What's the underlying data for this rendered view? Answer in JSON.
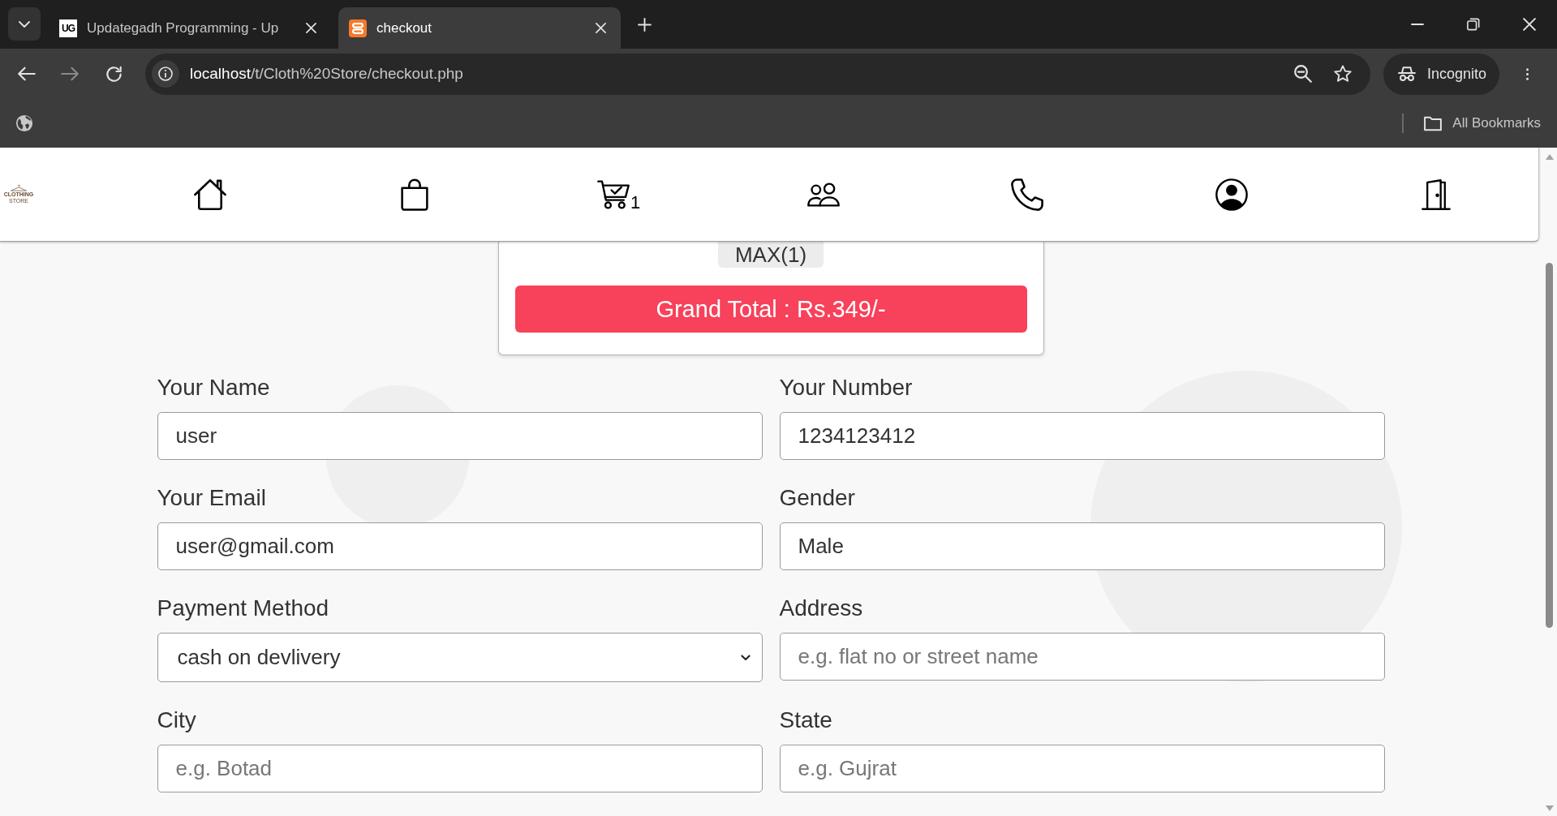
{
  "browser": {
    "tabs": [
      {
        "title": "Updategadh Programming - Up",
        "favicon_text": "UG",
        "selected": false
      },
      {
        "title": "checkout",
        "selected": true
      }
    ],
    "address": {
      "host": "localhost",
      "path": "/t/Cloth%20Store/checkout.php"
    },
    "profile": "Incognito",
    "bookmarks_folder": "All Bookmarks"
  },
  "site": {
    "logo": {
      "name": "CLOTHING",
      "tagline": "STORE"
    },
    "nav": [
      {
        "kind": "home"
      },
      {
        "kind": "bag"
      },
      {
        "kind": "cart",
        "count": "1"
      },
      {
        "kind": "people"
      },
      {
        "kind": "phone"
      },
      {
        "kind": "account"
      },
      {
        "kind": "door"
      }
    ]
  },
  "order": {
    "items": [
      "MAX(1)"
    ],
    "grand_total": "Grand Total : Rs.349/-"
  },
  "form": {
    "fields": [
      {
        "label": "Your Name",
        "kind": "input",
        "value": "user"
      },
      {
        "label": "Your Number",
        "kind": "input",
        "value": "1234123412"
      },
      {
        "label": "Your Email",
        "kind": "input",
        "value": "user@gmail.com"
      },
      {
        "label": "Gender",
        "kind": "input",
        "value": "Male"
      },
      {
        "label": "Payment Method",
        "kind": "select",
        "value": "cash on devlivery"
      },
      {
        "label": "Address",
        "kind": "input",
        "placeholder": "e.g. flat no or street name"
      },
      {
        "label": "City",
        "kind": "input",
        "placeholder": "e.g. Botad"
      },
      {
        "label": "State",
        "kind": "input",
        "placeholder": "e.g. Gujrat"
      }
    ]
  }
}
